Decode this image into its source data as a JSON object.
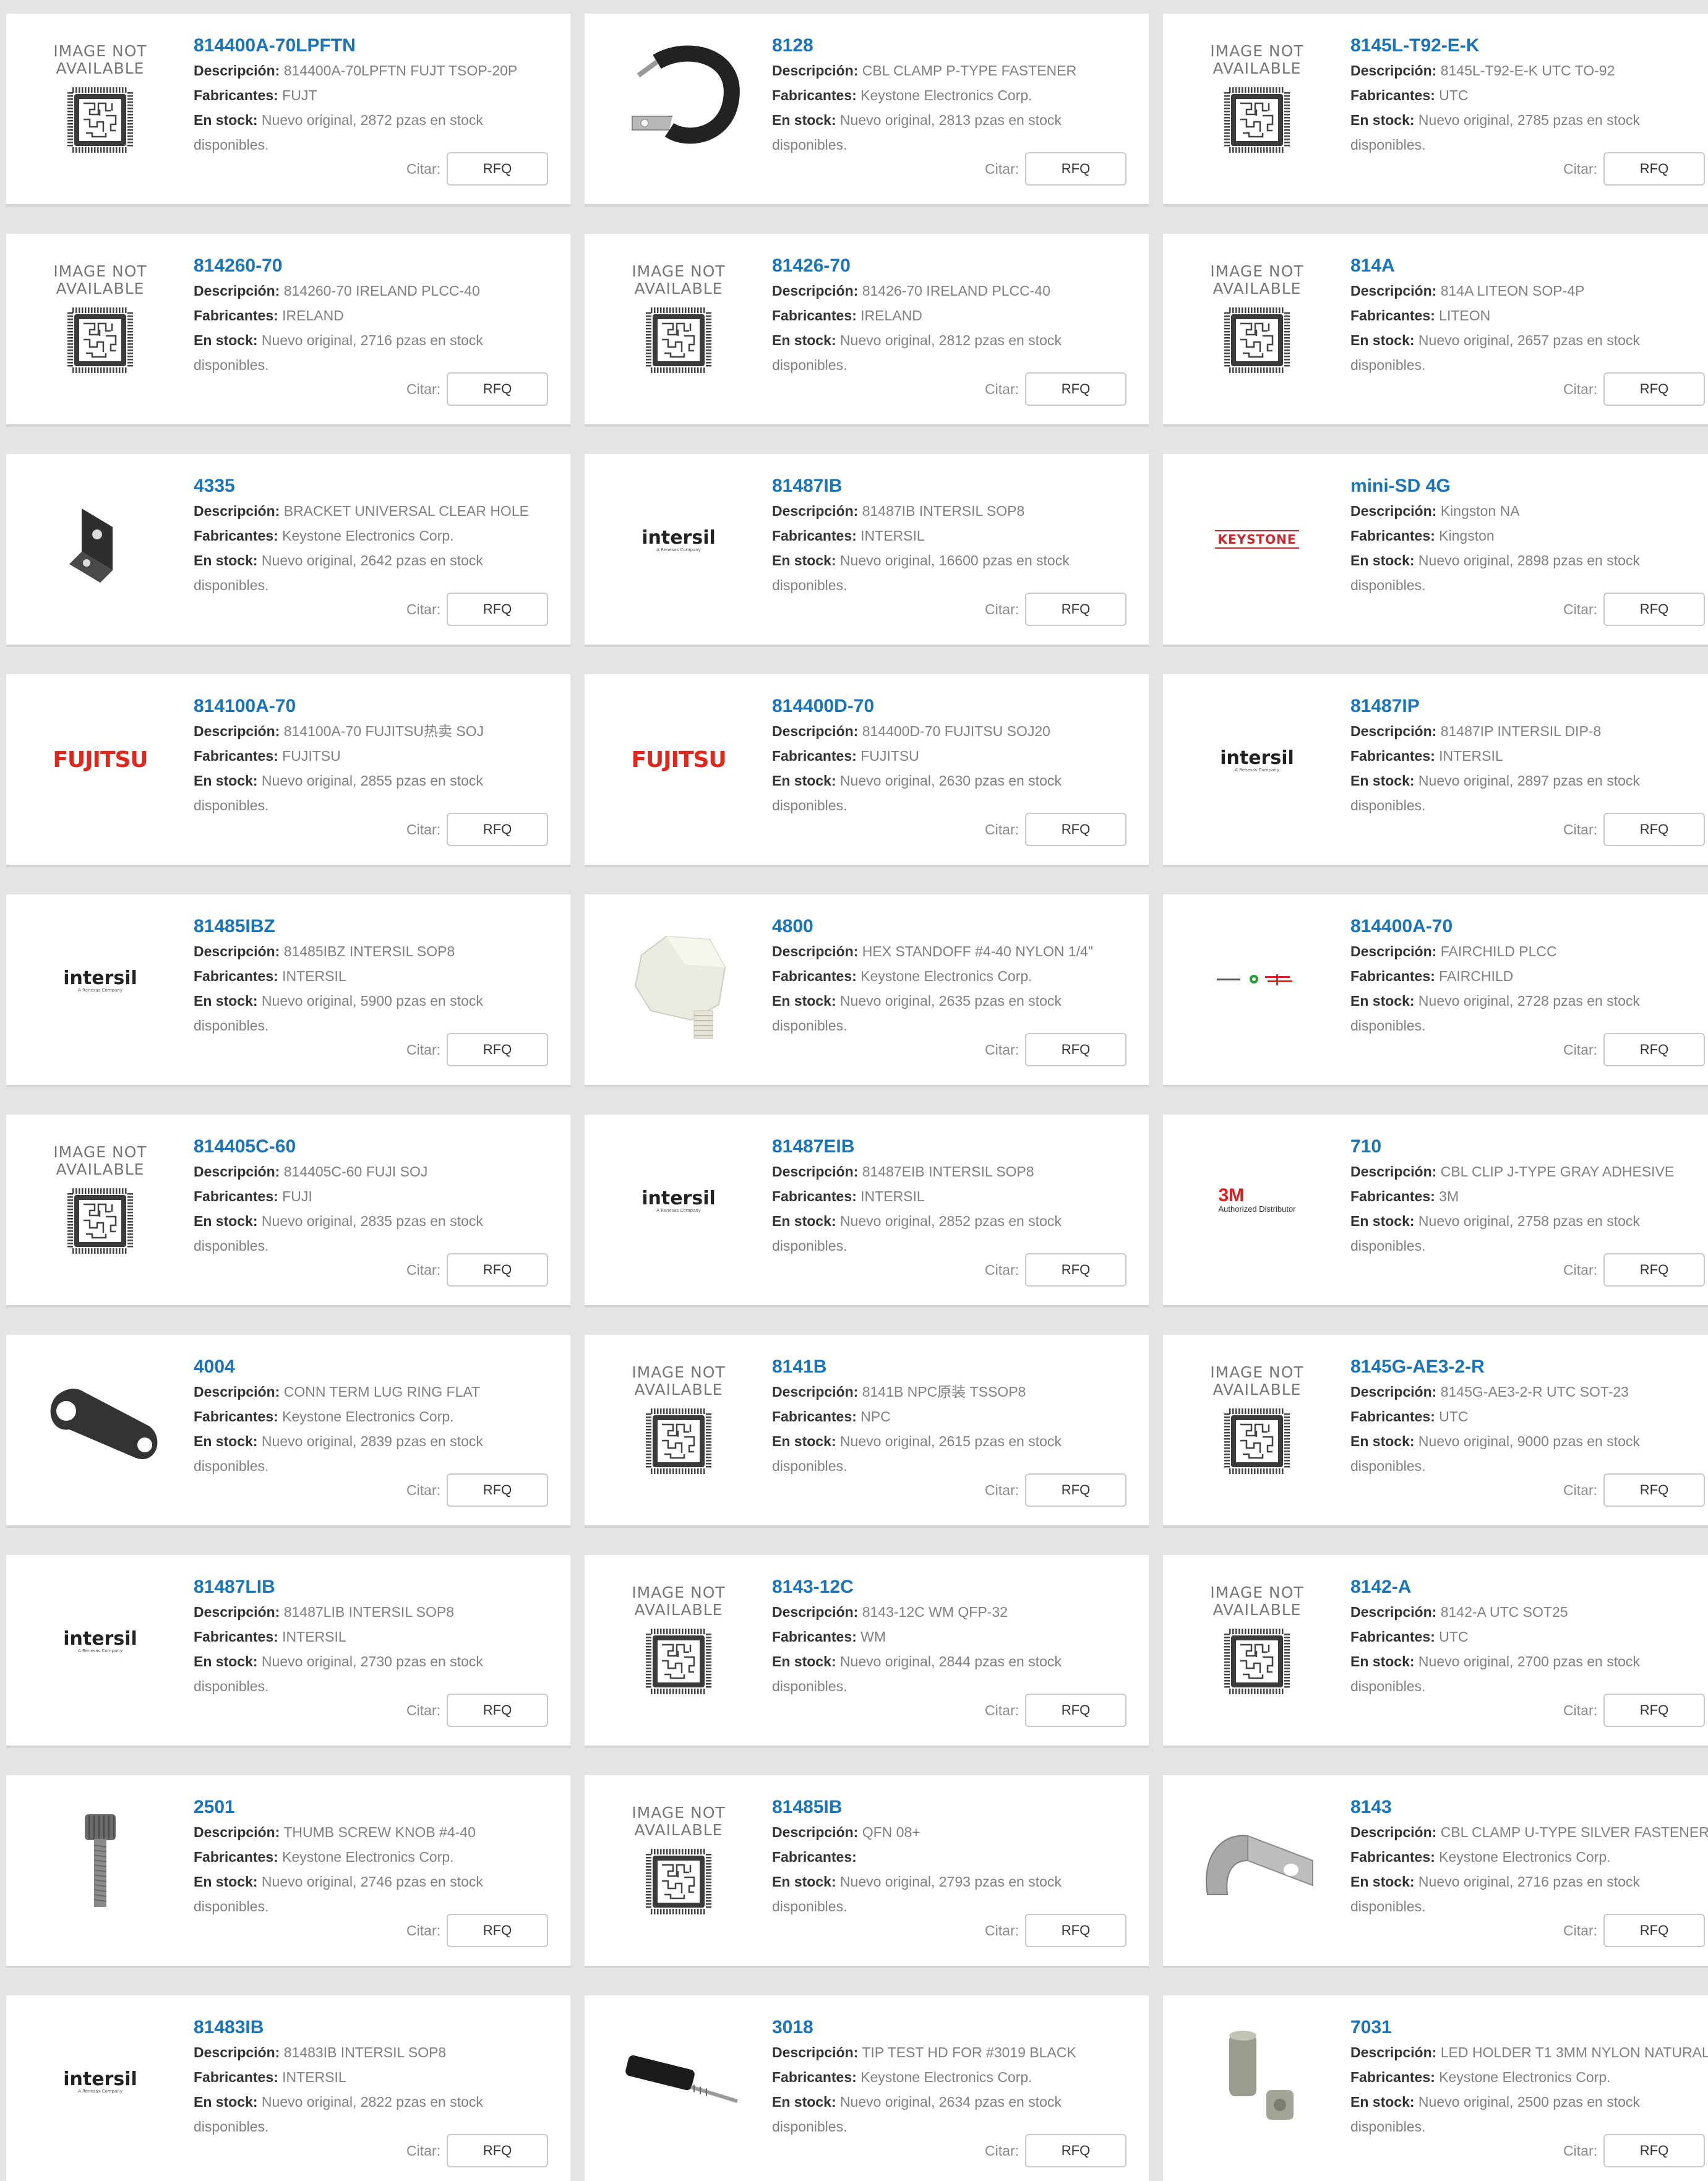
{
  "labels": {
    "descripcion": "Descripción:",
    "fabricantes": "Fabricantes:",
    "en_stock": "En stock:",
    "citar": "Citar:",
    "rfq": "RFQ"
  },
  "placeholder_image": {
    "line1": "IMAGE NOT",
    "line2": "AVAILABLE"
  },
  "logos": {
    "intersil": "intersil",
    "intersil_sub": "A Renesas Company",
    "fujitsu": "FUJITSU",
    "keystone": "KEYSTONE",
    "threem": "3M",
    "threem_sub": "Authorized Distributor"
  },
  "products": [
    {
      "part": "814400A-70LPFTN",
      "desc": "814400A-70LPFTN FUJT TSOP-20P",
      "mfr": "FUJT",
      "stock": "Nuevo original, 2872 pzas en stock disponibles.",
      "image": "not-available"
    },
    {
      "part": "8128",
      "desc": "CBL CLAMP P-TYPE FASTENER",
      "mfr": "Keystone Electronics Corp.",
      "stock": "Nuevo original, 2813 pzas en stock disponibles.",
      "image": "p-clamp"
    },
    {
      "part": "8145L-T92-E-K",
      "desc": "8145L-T92-E-K UTC TO-92",
      "mfr": "UTC",
      "stock": "Nuevo original, 2785 pzas en stock disponibles.",
      "image": "not-available"
    },
    {
      "part": "814260-70",
      "desc": "814260-70 IRELAND PLCC-40",
      "mfr": "IRELAND",
      "stock": "Nuevo original, 2716 pzas en stock disponibles.",
      "image": "not-available"
    },
    {
      "part": "81426-70",
      "desc": "81426-70 IRELAND PLCC-40",
      "mfr": "IRELAND",
      "stock": "Nuevo original, 2812 pzas en stock disponibles.",
      "image": "not-available"
    },
    {
      "part": "814A",
      "desc": "814A LITEON SOP-4P",
      "mfr": "LITEON",
      "stock": "Nuevo original, 2657 pzas en stock disponibles.",
      "image": "not-available"
    },
    {
      "part": "4335",
      "desc": "BRACKET UNIVERSAL CLEAR HOLE",
      "mfr": "Keystone Electronics Corp.",
      "stock": "Nuevo original, 2642 pzas en stock disponibles.",
      "image": "bracket"
    },
    {
      "part": "81487IB",
      "desc": "81487IB INTERSIL SOP8",
      "mfr": "INTERSIL",
      "stock": "Nuevo original, 16600 pzas en stock disponibles.",
      "image": "intersil"
    },
    {
      "part": "mini-SD 4G",
      "desc": "Kingston NA",
      "mfr": "Kingston",
      "stock": "Nuevo original, 2898 pzas en stock disponibles.",
      "image": "keystone"
    },
    {
      "part": "814100A-70",
      "desc": "814100A-70 FUJITSU热卖 SOJ",
      "mfr": "FUJITSU",
      "stock": "Nuevo original, 2855 pzas en stock disponibles.",
      "image": "fujitsu"
    },
    {
      "part": "814400D-70",
      "desc": "814400D-70 FUJITSU SOJ20",
      "mfr": "FUJITSU",
      "stock": "Nuevo original, 2630 pzas en stock disponibles.",
      "image": "fujitsu"
    },
    {
      "part": "81487IP",
      "desc": "81487IP INTERSIL DIP-8",
      "mfr": "INTERSIL",
      "stock": "Nuevo original, 2897 pzas en stock disponibles.",
      "image": "intersil"
    },
    {
      "part": "81485IBZ",
      "desc": "81485IBZ INTERSIL SOP8",
      "mfr": "INTERSIL",
      "stock": "Nuevo original, 5900 pzas en stock disponibles.",
      "image": "intersil"
    },
    {
      "part": "4800",
      "desc": "HEX STANDOFF #4-40 NYLON 1/4\"",
      "mfr": "Keystone Electronics Corp.",
      "stock": "Nuevo original, 2635 pzas en stock disponibles.",
      "image": "standoff"
    },
    {
      "part": "814400A-70",
      "desc": "FAIRCHILD PLCC",
      "mfr": "FAIRCHILD",
      "stock": "Nuevo original, 2728 pzas en stock disponibles.",
      "image": "fairchild"
    },
    {
      "part": "814405C-60",
      "desc": "814405C-60 FUJI SOJ",
      "mfr": "FUJI",
      "stock": "Nuevo original, 2835 pzas en stock disponibles.",
      "image": "not-available"
    },
    {
      "part": "81487EIB",
      "desc": "81487EIB INTERSIL SOP8",
      "mfr": "INTERSIL",
      "stock": "Nuevo original, 2852 pzas en stock disponibles.",
      "image": "intersil"
    },
    {
      "part": "710",
      "desc": "CBL CLIP J-TYPE GRAY ADHESIVE",
      "mfr": "3M",
      "stock": "Nuevo original, 2758 pzas en stock disponibles.",
      "image": "3m"
    },
    {
      "part": "4004",
      "desc": "CONN TERM LUG RING FLAT",
      "mfr": "Keystone Electronics Corp.",
      "stock": "Nuevo original, 2839 pzas en stock disponibles.",
      "image": "lug"
    },
    {
      "part": "8141B",
      "desc": "8141B NPC原装 TSSOP8",
      "mfr": "NPC",
      "stock": "Nuevo original, 2615 pzas en stock disponibles.",
      "image": "not-available"
    },
    {
      "part": "8145G-AE3-2-R",
      "desc": "8145G-AE3-2-R UTC SOT-23",
      "mfr": "UTC",
      "stock": "Nuevo original, 9000 pzas en stock disponibles.",
      "image": "not-available"
    },
    {
      "part": "81487LIB",
      "desc": "81487LIB INTERSIL SOP8",
      "mfr": "INTERSIL",
      "stock": "Nuevo original, 2730 pzas en stock disponibles.",
      "image": "intersil"
    },
    {
      "part": "8143-12C",
      "desc": "8143-12C WM QFP-32",
      "mfr": "WM",
      "stock": "Nuevo original, 2844 pzas en stock disponibles.",
      "image": "not-available"
    },
    {
      "part": "8142-A",
      "desc": "8142-A UTC SOT25",
      "mfr": "UTC",
      "stock": "Nuevo original, 2700 pzas en stock disponibles.",
      "image": "not-available"
    },
    {
      "part": "2501",
      "desc": "THUMB SCREW KNOB #4-40",
      "mfr": "Keystone Electronics Corp.",
      "stock": "Nuevo original, 2746 pzas en stock disponibles.",
      "image": "thumbscrew"
    },
    {
      "part": "81485IB",
      "desc": "QFN 08+",
      "mfr": "",
      "stock": "Nuevo original, 2793 pzas en stock disponibles.",
      "image": "not-available"
    },
    {
      "part": "8143",
      "desc": "CBL CLAMP U-TYPE SILVER FASTENER",
      "mfr": "Keystone Electronics Corp.",
      "stock": "Nuevo original, 2716 pzas en stock disponibles.",
      "image": "u-clamp"
    },
    {
      "part": "81483IB",
      "desc": "81483IB INTERSIL SOP8",
      "mfr": "INTERSIL",
      "stock": "Nuevo original, 2822 pzas en stock disponibles.",
      "image": "intersil"
    },
    {
      "part": "3018",
      "desc": "TIP TEST HD FOR #3019 BLACK",
      "mfr": "Keystone Electronics Corp.",
      "stock": "Nuevo original, 2634 pzas en stock disponibles.",
      "image": "test-tip"
    },
    {
      "part": "7031",
      "desc": "LED HOLDER T1 3MM NYLON NATURAL",
      "mfr": "Keystone Electronics Corp.",
      "stock": "Nuevo original, 2500 pzas en stock disponibles.",
      "image": "led-holder"
    }
  ]
}
